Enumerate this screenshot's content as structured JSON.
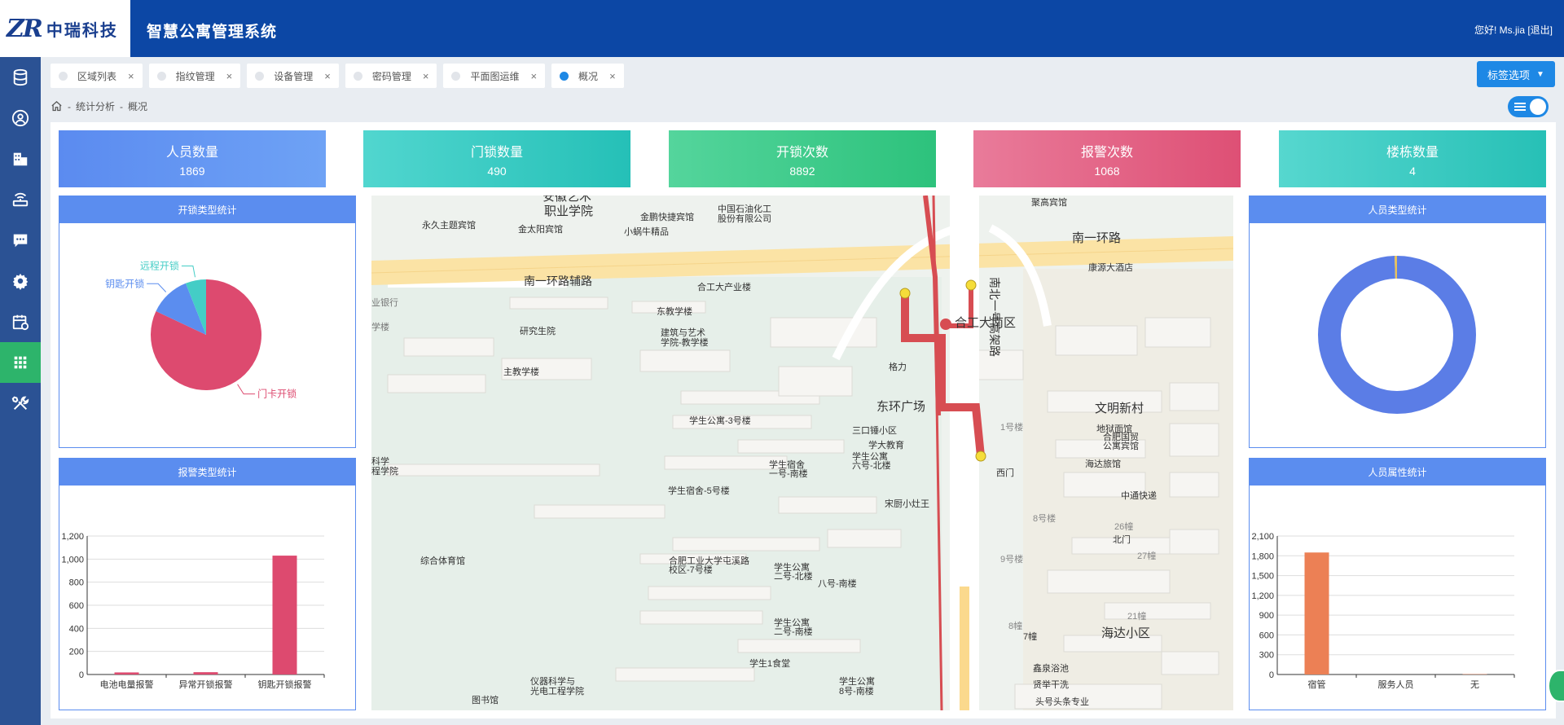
{
  "header": {
    "logo_mark": "ZR",
    "logo_text": "中瑞科技",
    "app_title": "智慧公寓管理系统",
    "user_text": "您好! Ms.jia [退出]"
  },
  "sidebar": {
    "items": [
      {
        "icon": "database-icon"
      },
      {
        "icon": "user-icon"
      },
      {
        "icon": "building-icon"
      },
      {
        "icon": "router-icon"
      },
      {
        "icon": "message-icon"
      },
      {
        "icon": "gear-icon"
      },
      {
        "icon": "calendar-icon"
      },
      {
        "icon": "grid-icon",
        "active": true
      },
      {
        "icon": "tools-icon"
      }
    ]
  },
  "tabs": [
    {
      "label": "区域列表",
      "close": "×"
    },
    {
      "label": "指纹管理",
      "close": "×"
    },
    {
      "label": "设备管理",
      "close": "×"
    },
    {
      "label": "密码管理",
      "close": "×"
    },
    {
      "label": "平面图运维",
      "close": "×"
    },
    {
      "label": "概况",
      "close": "×",
      "active": true
    }
  ],
  "tag_select": {
    "label": "标签选项",
    "caret": "▼"
  },
  "breadcrumb": {
    "sep": "-",
    "level1": "统计分析",
    "level2": "概况"
  },
  "stats": [
    {
      "label": "人员数量",
      "value": "1869"
    },
    {
      "label": "门锁数量",
      "value": "490"
    },
    {
      "label": "开锁次数",
      "value": "8892"
    },
    {
      "label": "报警次数",
      "value": "1068"
    },
    {
      "label": "楼栋数量",
      "value": "4"
    }
  ],
  "panels": {
    "unlock_type": {
      "title": "开锁类型统计"
    },
    "alarm_type": {
      "title": "报警类型统计"
    },
    "person_type": {
      "title": "人员类型统计"
    },
    "person_attr": {
      "title": "人员属性统计"
    }
  },
  "chart_data": [
    {
      "type": "pie",
      "title": "开锁类型统计",
      "categories": [
        "门卡开锁",
        "钥匙开锁",
        "远程开锁"
      ],
      "values": [
        82,
        12,
        6
      ],
      "colors": [
        "#dd4a6f",
        "#5b8def",
        "#44cdc6"
      ]
    },
    {
      "type": "bar",
      "title": "报警类型统计",
      "categories": [
        "电池电量报警",
        "异常开锁报警",
        "钥匙开锁报警"
      ],
      "values": [
        18,
        20,
        1030
      ],
      "ylim": [
        0,
        1200
      ],
      "yticks": [
        "0",
        "200",
        "400",
        "600",
        "800",
        "1,000",
        "1,200"
      ],
      "color": "#dd4a6f"
    },
    {
      "type": "pie",
      "title": "人员类型统计",
      "values": [
        1859,
        10
      ],
      "colors": [
        "#5b7de6",
        "#e8c15a"
      ]
    },
    {
      "type": "bar",
      "title": "人员属性统计",
      "categories": [
        "宿管",
        "服务人员",
        "无"
      ],
      "values": [
        1850,
        0,
        5
      ],
      "ylim": [
        0,
        2100
      ],
      "yticks": [
        "0",
        "300",
        "600",
        "900",
        "1,200",
        "1,500",
        "1,800",
        "2,100"
      ],
      "color": "#ec8055"
    }
  ],
  "map": {
    "labels": [
      "安徽艺术",
      "职业学院",
      "中国石油化工",
      "股份有限公司",
      "永久主题宾馆",
      "金太阳宾馆",
      "小蜗牛精品",
      "金鹏快捷宾馆",
      "南一环路辅路",
      "南一环路",
      "合工大产业楼",
      "东教学楼",
      "建筑与艺术",
      "学院-教学楼",
      "研究生院",
      "主教学楼",
      "学生公寓-3号楼",
      "学生宿舍-5号楼",
      "综合体育馆",
      "合肥工业大学屯溪路",
      "校区-7号楼",
      "学生1食堂",
      "仪器科学与",
      "光电工程学院",
      "图书馆",
      "格力",
      "东环广场",
      "三口锤小区",
      "学大教育",
      "宋厨小灶王",
      "合工大南区",
      "南北一号高架路",
      "文明新村",
      "地狱面馆",
      "海达旅馆",
      "中通快递",
      "康源大酒店",
      "海达小区",
      "西门",
      "北门",
      "鑫泉浴池",
      "贤举干洗",
      "1号楼",
      "8号楼",
      "9号楼",
      "7幢",
      "26幢",
      "27幢",
      "21幢",
      "8幢",
      "学生宿舍",
      "一号-南楼",
      "学生公寓",
      "六号-北楼",
      "学生公寓",
      "二号-北楼",
      "学生公寓",
      "二号-南楼",
      "八号-南楼",
      "学生公寓",
      "8号-南楼",
      "合肥国贸",
      "公寓宾馆",
      "聚高宾馆",
      "头号头条专业",
      "科学",
      "程学院",
      "业银行",
      "学楼"
    ]
  }
}
